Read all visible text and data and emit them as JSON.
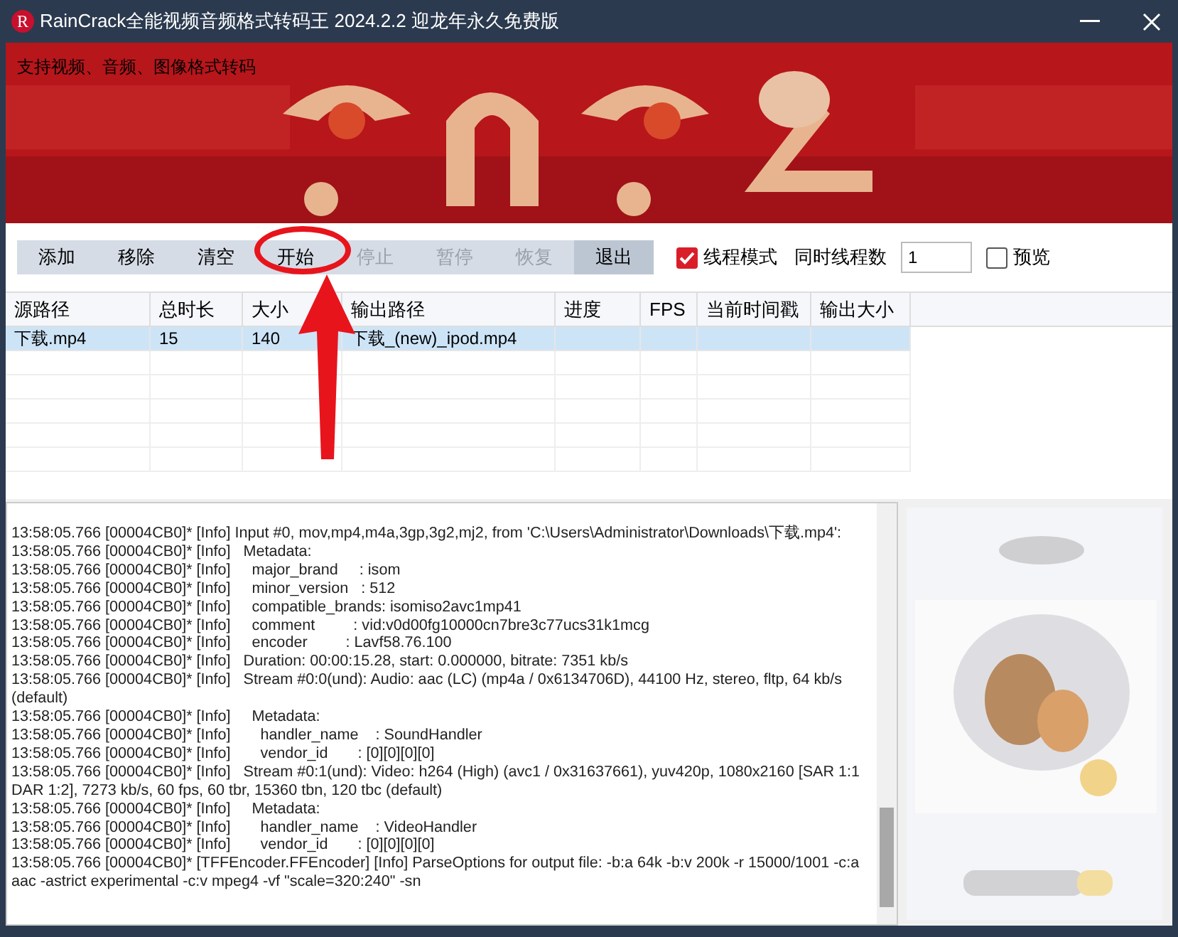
{
  "window": {
    "title": "RainCrack全能视频音频格式转码王 2024.2.2 迎龙年永久免费版",
    "logo": "R"
  },
  "banner": {
    "caption": "支持视频、音频、图像格式转码"
  },
  "toolbar": {
    "buttons": [
      {
        "label": "添加",
        "disabled": false,
        "kind": "normal"
      },
      {
        "label": "移除",
        "disabled": false,
        "kind": "normal"
      },
      {
        "label": "清空",
        "disabled": false,
        "kind": "normal"
      },
      {
        "label": "开始",
        "disabled": false,
        "kind": "normal"
      },
      {
        "label": "停止",
        "disabled": true,
        "kind": "normal"
      },
      {
        "label": "暂停",
        "disabled": true,
        "kind": "normal"
      },
      {
        "label": "恢复",
        "disabled": true,
        "kind": "normal"
      },
      {
        "label": "退出",
        "disabled": false,
        "kind": "dark"
      }
    ],
    "thread_mode": {
      "label": "线程模式",
      "checked": true
    },
    "thread_count": {
      "label": "同时线程数",
      "value": "1"
    },
    "preview": {
      "label": "预览",
      "checked": false
    }
  },
  "table": {
    "columns": [
      "源路径",
      "总时长",
      "大小",
      "输出路径",
      "进度",
      "FPS",
      "当前时间戳",
      "输出大小"
    ],
    "rows": [
      {
        "selected": true,
        "cells": [
          "下载.mp4",
          "15",
          "140",
          "下载_(new)_ipod.mp4",
          "",
          "",
          "",
          ""
        ]
      }
    ]
  },
  "log": {
    "lines": [
      "13:58:05.766 [00004CB0]* [Info] Input #0, mov,mp4,m4a,3gp,3g2,mj2, from 'C:\\Users\\Administrator\\Downloads\\下载.mp4':",
      "13:58:05.766 [00004CB0]* [Info]   Metadata:",
      "13:58:05.766 [00004CB0]* [Info]     major_brand     : isom",
      "13:58:05.766 [00004CB0]* [Info]     minor_version   : 512",
      "13:58:05.766 [00004CB0]* [Info]     compatible_brands: isomiso2avc1mp41",
      "13:58:05.766 [00004CB0]* [Info]     comment         : vid:v0d00fg10000cn7bre3c77ucs31k1mcg",
      "13:58:05.766 [00004CB0]* [Info]     encoder         : Lavf58.76.100",
      "13:58:05.766 [00004CB0]* [Info]   Duration: 00:00:15.28, start: 0.000000, bitrate: 7351 kb/s",
      "13:58:05.766 [00004CB0]* [Info]   Stream #0:0(und): Audio: aac (LC) (mp4a / 0x6134706D), 44100 Hz, stereo, fltp, 64 kb/s (default)",
      "13:58:05.766 [00004CB0]* [Info]     Metadata:",
      "13:58:05.766 [00004CB0]* [Info]       handler_name    : SoundHandler",
      "13:58:05.766 [00004CB0]* [Info]       vendor_id       : [0][0][0][0]",
      "13:58:05.766 [00004CB0]* [Info]   Stream #0:1(und): Video: h264 (High) (avc1 / 0x31637661), yuv420p, 1080x2160 [SAR 1:1 DAR 1:2], 7273 kb/s, 60 fps, 60 tbr, 15360 tbn, 120 tbc (default)",
      "13:58:05.766 [00004CB0]* [Info]     Metadata:",
      "13:58:05.766 [00004CB0]* [Info]       handler_name    : VideoHandler",
      "13:58:05.766 [00004CB0]* [Info]       vendor_id       : [0][0][0][0]",
      "13:58:05.766 [00004CB0]* [TFFEncoder.FFEncoder] [Info] ParseOptions for output file: -b:a 64k -b:v 200k -r 15000/1001 -c:a aac -astrict experimental -c:v mpeg4 -vf \"scale=320:240\" -sn"
    ]
  }
}
